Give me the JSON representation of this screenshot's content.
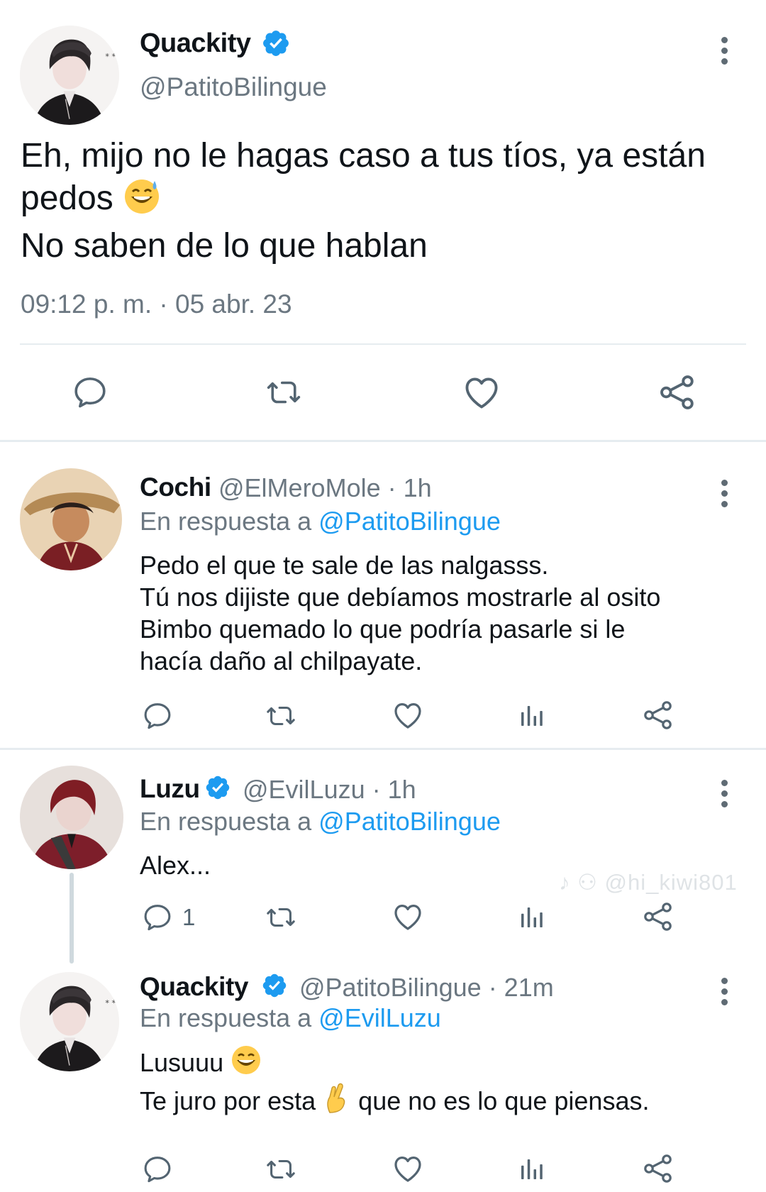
{
  "colors": {
    "accent": "#1d9bf0",
    "secondary_text": "#6b7781",
    "divider": "#e6ecf0"
  },
  "main_tweet": {
    "author_name": "Quackity",
    "handle": "@PatitoBilingue",
    "verified_icon": "verified-badge-icon",
    "text_lines": [
      "Eh, mijo no le hagas caso a tus tíos, ya están",
      "pedos",
      "No saben de lo que hablan"
    ],
    "emoji": "😅",
    "timestamp": "09:12 p. m. · 05 abr. 23",
    "actions": [
      "reply-icon",
      "retweet-icon",
      "like-icon",
      "share-icon"
    ]
  },
  "replies": [
    {
      "author_name": "Cochi",
      "handle": "@ElMeroMole · 1h",
      "replying_prefix": "En respuesta a ",
      "replying_to": "@PatitoBilingue",
      "text_lines": [
        "Pedo el que te sale de las nalgasss.",
        "Tú nos dijiste que debíamos mostrarle al osito",
        "Bimbo quemado lo que podría pasarle si le",
        "hacía daño al chilpayate."
      ],
      "reply_count": ""
    },
    {
      "author_name": "Luzu",
      "handle": "@EvilLuzu · 1h",
      "replying_prefix": "En respuesta a ",
      "replying_to": "@PatitoBilingue",
      "text_lines": [
        "Alex..."
      ],
      "reply_count": "1"
    },
    {
      "author_name": "Quackity",
      "handle": "@PatitoBilingue · 21m",
      "replying_prefix": "En respuesta a ",
      "replying_to": "@EvilLuzu",
      "text_line_1": "Lusuuu",
      "text_line_2a": "Te juro por esta",
      "text_line_2b": "que no es lo que piensas.",
      "emoji_1": "😄",
      "emoji_2": "🤞",
      "reply_count": ""
    }
  ],
  "watermark": "@hi_kiwi801"
}
